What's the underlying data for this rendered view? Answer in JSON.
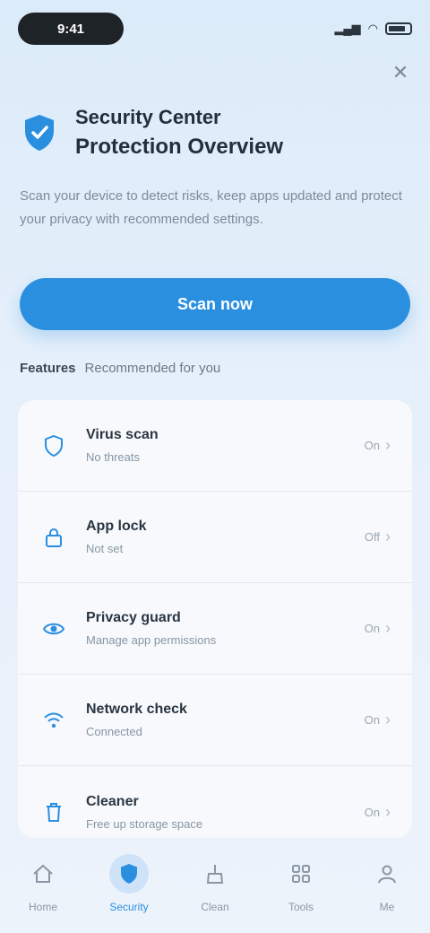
{
  "status": {
    "time": "9:41"
  },
  "header": {
    "title_line1": "Security Center",
    "title_line2": "Protection Overview"
  },
  "description": "Scan your device to detect risks, keep apps updated and protect your privacy with recommended settings.",
  "cta": {
    "label": "Scan now"
  },
  "section": {
    "title": "Features",
    "subtitle": "Recommended for you"
  },
  "items": [
    {
      "title": "Virus scan",
      "subtitle": "No threats",
      "state": "On",
      "icon": "shield-icon"
    },
    {
      "title": "App lock",
      "subtitle": "Not set",
      "state": "Off",
      "icon": "lock-icon"
    },
    {
      "title": "Privacy guard",
      "subtitle": "Manage app permissions",
      "state": "On",
      "icon": "eye-icon"
    },
    {
      "title": "Network check",
      "subtitle": "Connected",
      "state": "On",
      "icon": "wifi-icon"
    },
    {
      "title": "Cleaner",
      "subtitle": "Free up storage space",
      "state": "On",
      "icon": "trash-icon"
    }
  ],
  "tabs": [
    {
      "label": "Home",
      "icon": "home-icon",
      "active": false
    },
    {
      "label": "Security",
      "icon": "shield-icon",
      "active": true
    },
    {
      "label": "Clean",
      "icon": "broom-icon",
      "active": false
    },
    {
      "label": "Tools",
      "icon": "grid-icon",
      "active": false
    },
    {
      "label": "Me",
      "icon": "user-icon",
      "active": false
    }
  ],
  "colors": {
    "accent": "#2b8fe0",
    "background": "#dcebf9"
  }
}
